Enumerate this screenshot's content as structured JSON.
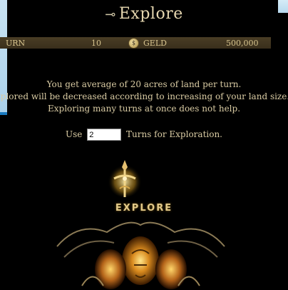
{
  "title": "Explore",
  "status": {
    "turn_label": "URN",
    "turn_value": "10",
    "geld_label": "GELD",
    "geld_value": "500,000"
  },
  "info": {
    "line1": "You get average of 20 acres of land per turn.",
    "line2": "xplored will be decreased according to increasing of your land size.",
    "line3": "Exploring many turns at once does not help."
  },
  "turns_prefix": "Use",
  "turns_value": "2",
  "turns_suffix": "Turns for Exploration.",
  "explore_button": "EXPLORE",
  "colors": {
    "accent": "#d7c48e",
    "bar": "#3a2f1c"
  }
}
